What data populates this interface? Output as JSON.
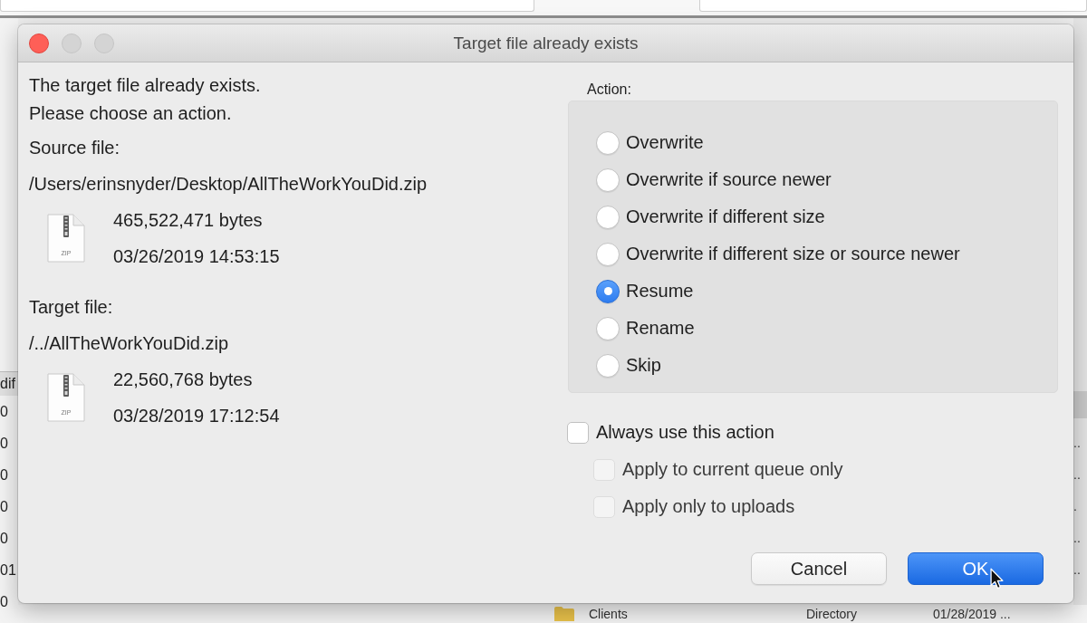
{
  "background": {
    "left_list": {
      "header": "dif",
      "rows": [
        "0",
        "0",
        "0",
        "0",
        "0",
        "01",
        "0"
      ]
    },
    "right_list": {
      "rows": [
        "..",
        "..",
        ".",
        "..",
        ".."
      ],
      "last_row": {
        "name": "Clients",
        "type": "Directory",
        "modified": "01/28/2019 ..."
      }
    }
  },
  "window": {
    "title": "Target file already exists",
    "controls": [
      {
        "kind": "close",
        "enabled": true
      },
      {
        "kind": "minimize",
        "enabled": false
      },
      {
        "kind": "zoom",
        "enabled": false
      }
    ]
  },
  "message": [
    "The target file already exists.",
    "Please choose an action."
  ],
  "files": [
    {
      "label": "Source file:",
      "path": "/Users/erinsnyder/Desktop/AllTheWorkYouDid.zip",
      "icon_label": "ZIP",
      "size": "465,522,471 bytes",
      "modified": "03/26/2019 14:53:15"
    },
    {
      "label": "Target file:",
      "path": "/../AllTheWorkYouDid.zip",
      "icon_label": "ZIP",
      "size": "22,560,768 bytes",
      "modified": "03/28/2019 17:12:54"
    }
  ],
  "action": {
    "label": "Action:",
    "options": [
      {
        "label": "Overwrite",
        "selected": false
      },
      {
        "label": "Overwrite if source newer",
        "selected": false
      },
      {
        "label": "Overwrite if different size",
        "selected": false
      },
      {
        "label": "Overwrite if different size or source newer",
        "selected": false
      },
      {
        "label": "Resume",
        "selected": true
      },
      {
        "label": "Rename",
        "selected": false
      },
      {
        "label": "Skip",
        "selected": false
      }
    ]
  },
  "options": [
    {
      "label": "Always use this action",
      "checked": false,
      "disabled": false,
      "children": [
        {
          "label": "Apply to current queue only",
          "checked": false,
          "disabled": true
        },
        {
          "label": "Apply only to uploads",
          "checked": false,
          "disabled": true
        }
      ]
    }
  ],
  "buttons": [
    {
      "label": "Cancel",
      "kind": "cancel"
    },
    {
      "label": "OK",
      "kind": "default"
    }
  ]
}
